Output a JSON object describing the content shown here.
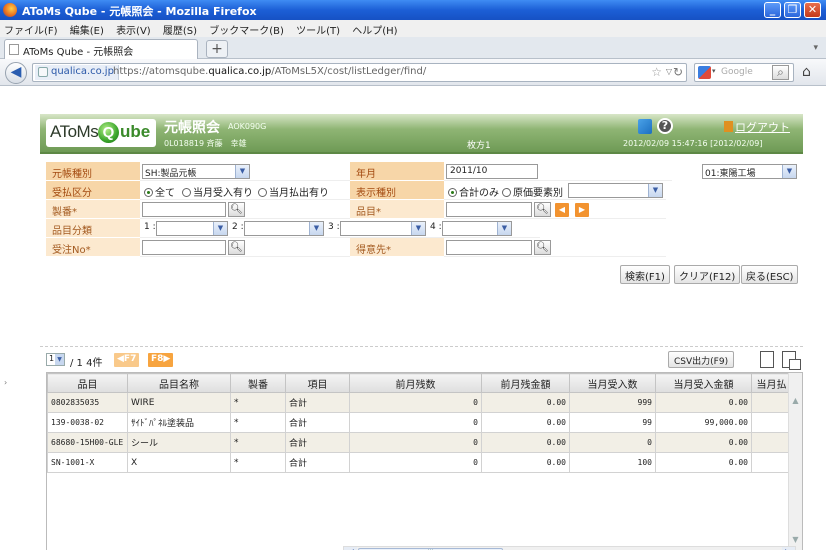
{
  "window": {
    "title": "AToMs Qube - 元帳照会 - Mozilla Firefox"
  },
  "menu": [
    "ファイル(F)",
    "編集(E)",
    "表示(V)",
    "履歴(S)",
    "ブックマーク(B)",
    "ツール(T)",
    "ヘルプ(H)"
  ],
  "tab": {
    "label": "AToMs Qube - 元帳照会",
    "new_tab": "+"
  },
  "nav": {
    "site": "qualica.co.jp",
    "url_prefix": "https://atomsqube.",
    "url_domain": "qualica.co.jp",
    "url_rest": "/AToMsL5X/cost/listLedger/find/",
    "search_placeholder": "Google"
  },
  "app": {
    "logo_left": "AToMs",
    "logo_q": "Q",
    "logo_right": "ube",
    "screen_title": "元帳照会",
    "screen_code": "AOK090G",
    "user_line": "0L018819 斉藤　幸雄",
    "plant_name": "枚方1",
    "logout": "ログアウト",
    "datetime": "2012/02/09 15:47:16 [2012/02/09]"
  },
  "criteria": {
    "ledger_type": {
      "label": "元帳種別",
      "value": "SH:製品元帳"
    },
    "yearmonth": {
      "label": "年月",
      "value": "2011/10"
    },
    "factory": {
      "value": "01:東陽工場"
    },
    "transaction_type": {
      "label": "受払区分",
      "options": [
        "全て",
        "当月受入有り",
        "当月払出有り"
      ],
      "selected": "全て"
    },
    "display_type": {
      "label": "表示種別",
      "options": [
        "合計のみ",
        "原価要素別"
      ],
      "selected": "合計のみ"
    },
    "lot_no": {
      "label": "製番*"
    },
    "item_code": {
      "label": "品目*"
    },
    "item_class": {
      "label": "品目分類",
      "prefixes": [
        "1 :",
        "2 :",
        "3 :",
        "4 :"
      ]
    },
    "order_no": {
      "label": "受注No*"
    },
    "customer": {
      "label": "得意先*"
    }
  },
  "buttons": {
    "search": "検索(F1)",
    "clear": "クリア(F12)",
    "back": "戻る(ESC)"
  },
  "results": {
    "page_value": "1",
    "page_summary": "/ 1 4件",
    "prev_key": "◀F7",
    "next_key": "F8▶",
    "csv_button": "CSV出力(F9)",
    "columns": [
      "品目",
      "品目名称",
      "製番",
      "項目",
      "前月残数",
      "前月残金額",
      "当月受入数",
      "当月受入金額",
      "当月払"
    ],
    "rows": [
      [
        "0802835035",
        "WIRE",
        "*",
        "合計",
        "0",
        "0.00",
        "999",
        "0.00",
        ""
      ],
      [
        "139-0038-02",
        "ｻｲﾄﾞﾊﾟﾈﾙ塗装品",
        "*",
        "合計",
        "0",
        "0.00",
        "99",
        "99,000.00",
        ""
      ],
      [
        "68680-15H00-GLE",
        "シール",
        "*",
        "合計",
        "0",
        "0.00",
        "0",
        "0.00",
        ""
      ],
      [
        "SN-1001-X",
        "X",
        "*",
        "合計",
        "0",
        "0.00",
        "100",
        "0.00",
        ""
      ]
    ]
  }
}
